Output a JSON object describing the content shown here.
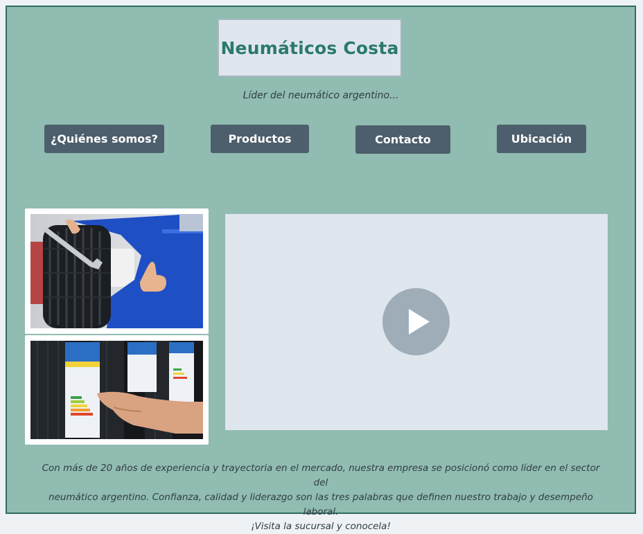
{
  "site": {
    "title": "Neumáticos Costa",
    "tagline": "Líder del neumático argentino..."
  },
  "nav": {
    "about": "¿Quiénes somos?",
    "products": "Productos",
    "contact": "Contacto",
    "location": "Ubicación"
  },
  "colors": {
    "page_background": "#91bcb1",
    "brand_text": "#2a7a6a",
    "button_background": "#4d5e6c",
    "video_background": "#e0e6ee"
  },
  "media": {
    "photo1_icon": "mechanic-with-tire-image",
    "photo2_icon": "tire-label-image",
    "video_icon": "play-icon"
  },
  "about": {
    "line1": "Con más de 20 años de experiencia y trayectoria en el mercado, nuestra empresa se posicionó como líder en el sector del",
    "line2": "neumático argentino. Confianza, calidad y liderazgo son las tres palabras que definen nuestro trabajo y desempeño laboral.",
    "line3": "¡Visita la sucursal y conocela!"
  }
}
